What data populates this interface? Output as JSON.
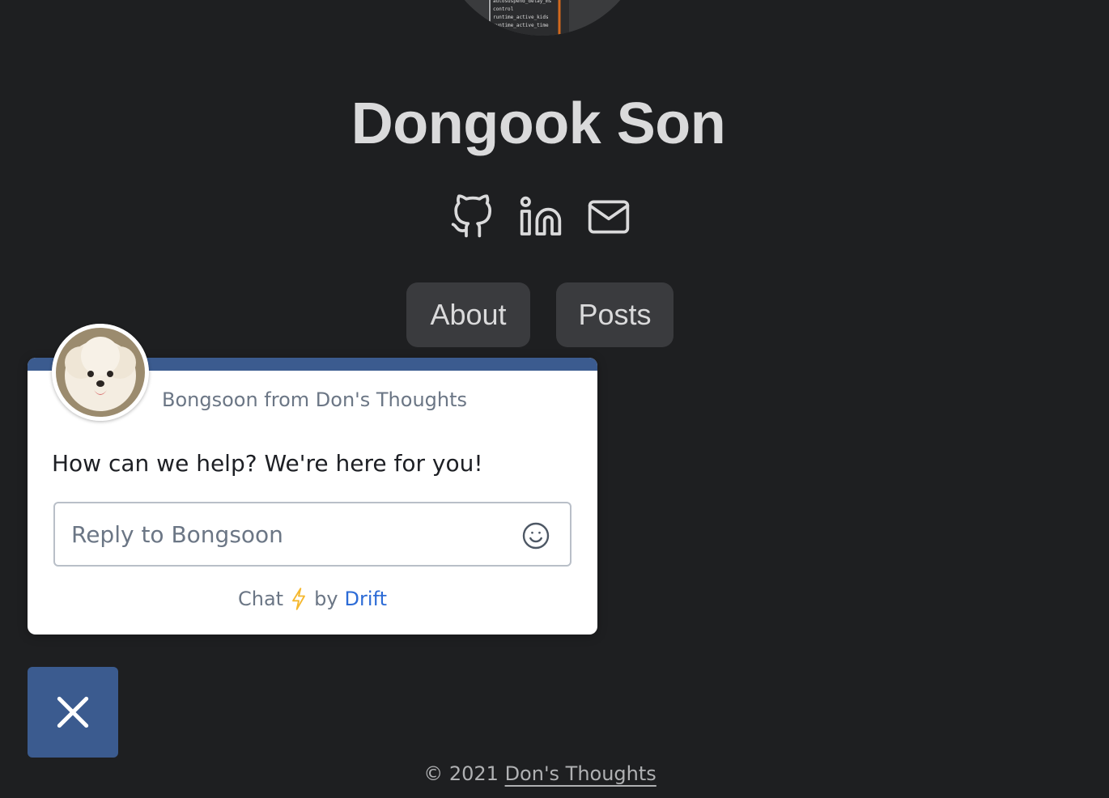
{
  "profile": {
    "name": "Dongook Son",
    "avatar_icon": "terminal-screenshot-avatar",
    "avatar_lines": [
      "autosuspend_delay_ms",
      "control",
      "runtime_active_kids",
      "runtime_active_time"
    ]
  },
  "social": [
    {
      "name": "github",
      "icon": "github-icon"
    },
    {
      "name": "linkedin",
      "icon": "linkedin-icon"
    },
    {
      "name": "email",
      "icon": "mail-icon"
    }
  ],
  "nav": {
    "about_label": "About",
    "posts_label": "Posts"
  },
  "chat": {
    "sender": "Bongsoon from Don's Thoughts",
    "message": "How can we help? We're here for you!",
    "reply_placeholder": "Reply to Bongsoon",
    "footer_chat": "Chat",
    "footer_by": "by",
    "footer_brand": "Drift",
    "accent_color": "#3b5b8f",
    "brand_link_color": "#2c6bd6",
    "bolt_color": "#f5b82e"
  },
  "footer": {
    "copyright_prefix": "© 2021",
    "site_link": "Don's Thoughts"
  }
}
